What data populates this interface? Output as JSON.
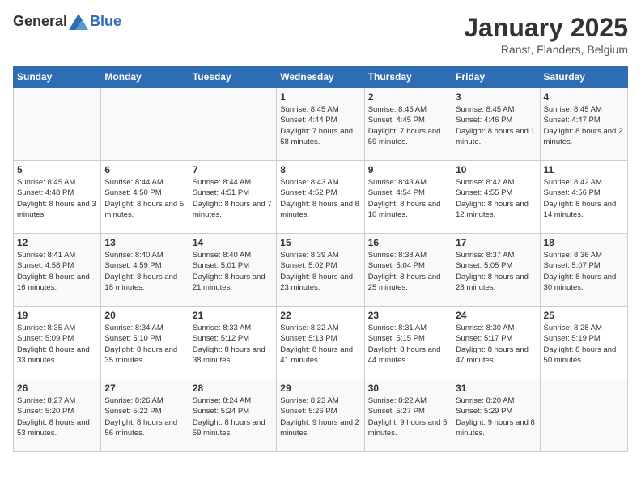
{
  "logo": {
    "general": "General",
    "blue": "Blue"
  },
  "title": "January 2025",
  "subtitle": "Ranst, Flanders, Belgium",
  "weekdays": [
    "Sunday",
    "Monday",
    "Tuesday",
    "Wednesday",
    "Thursday",
    "Friday",
    "Saturday"
  ],
  "weeks": [
    [
      {
        "day": "",
        "sunrise": "",
        "sunset": "",
        "daylight": ""
      },
      {
        "day": "",
        "sunrise": "",
        "sunset": "",
        "daylight": ""
      },
      {
        "day": "",
        "sunrise": "",
        "sunset": "",
        "daylight": ""
      },
      {
        "day": "1",
        "sunrise": "Sunrise: 8:45 AM",
        "sunset": "Sunset: 4:44 PM",
        "daylight": "Daylight: 7 hours and 58 minutes."
      },
      {
        "day": "2",
        "sunrise": "Sunrise: 8:45 AM",
        "sunset": "Sunset: 4:45 PM",
        "daylight": "Daylight: 7 hours and 59 minutes."
      },
      {
        "day": "3",
        "sunrise": "Sunrise: 8:45 AM",
        "sunset": "Sunset: 4:46 PM",
        "daylight": "Daylight: 8 hours and 1 minute."
      },
      {
        "day": "4",
        "sunrise": "Sunrise: 8:45 AM",
        "sunset": "Sunset: 4:47 PM",
        "daylight": "Daylight: 8 hours and 2 minutes."
      }
    ],
    [
      {
        "day": "5",
        "sunrise": "Sunrise: 8:45 AM",
        "sunset": "Sunset: 4:48 PM",
        "daylight": "Daylight: 8 hours and 3 minutes."
      },
      {
        "day": "6",
        "sunrise": "Sunrise: 8:44 AM",
        "sunset": "Sunset: 4:50 PM",
        "daylight": "Daylight: 8 hours and 5 minutes."
      },
      {
        "day": "7",
        "sunrise": "Sunrise: 8:44 AM",
        "sunset": "Sunset: 4:51 PM",
        "daylight": "Daylight: 8 hours and 7 minutes."
      },
      {
        "day": "8",
        "sunrise": "Sunrise: 8:43 AM",
        "sunset": "Sunset: 4:52 PM",
        "daylight": "Daylight: 8 hours and 8 minutes."
      },
      {
        "day": "9",
        "sunrise": "Sunrise: 8:43 AM",
        "sunset": "Sunset: 4:54 PM",
        "daylight": "Daylight: 8 hours and 10 minutes."
      },
      {
        "day": "10",
        "sunrise": "Sunrise: 8:42 AM",
        "sunset": "Sunset: 4:55 PM",
        "daylight": "Daylight: 8 hours and 12 minutes."
      },
      {
        "day": "11",
        "sunrise": "Sunrise: 8:42 AM",
        "sunset": "Sunset: 4:56 PM",
        "daylight": "Daylight: 8 hours and 14 minutes."
      }
    ],
    [
      {
        "day": "12",
        "sunrise": "Sunrise: 8:41 AM",
        "sunset": "Sunset: 4:58 PM",
        "daylight": "Daylight: 8 hours and 16 minutes."
      },
      {
        "day": "13",
        "sunrise": "Sunrise: 8:40 AM",
        "sunset": "Sunset: 4:59 PM",
        "daylight": "Daylight: 8 hours and 18 minutes."
      },
      {
        "day": "14",
        "sunrise": "Sunrise: 8:40 AM",
        "sunset": "Sunset: 5:01 PM",
        "daylight": "Daylight: 8 hours and 21 minutes."
      },
      {
        "day": "15",
        "sunrise": "Sunrise: 8:39 AM",
        "sunset": "Sunset: 5:02 PM",
        "daylight": "Daylight: 8 hours and 23 minutes."
      },
      {
        "day": "16",
        "sunrise": "Sunrise: 8:38 AM",
        "sunset": "Sunset: 5:04 PM",
        "daylight": "Daylight: 8 hours and 25 minutes."
      },
      {
        "day": "17",
        "sunrise": "Sunrise: 8:37 AM",
        "sunset": "Sunset: 5:05 PM",
        "daylight": "Daylight: 8 hours and 28 minutes."
      },
      {
        "day": "18",
        "sunrise": "Sunrise: 8:36 AM",
        "sunset": "Sunset: 5:07 PM",
        "daylight": "Daylight: 8 hours and 30 minutes."
      }
    ],
    [
      {
        "day": "19",
        "sunrise": "Sunrise: 8:35 AM",
        "sunset": "Sunset: 5:09 PM",
        "daylight": "Daylight: 8 hours and 33 minutes."
      },
      {
        "day": "20",
        "sunrise": "Sunrise: 8:34 AM",
        "sunset": "Sunset: 5:10 PM",
        "daylight": "Daylight: 8 hours and 35 minutes."
      },
      {
        "day": "21",
        "sunrise": "Sunrise: 8:33 AM",
        "sunset": "Sunset: 5:12 PM",
        "daylight": "Daylight: 8 hours and 38 minutes."
      },
      {
        "day": "22",
        "sunrise": "Sunrise: 8:32 AM",
        "sunset": "Sunset: 5:13 PM",
        "daylight": "Daylight: 8 hours and 41 minutes."
      },
      {
        "day": "23",
        "sunrise": "Sunrise: 8:31 AM",
        "sunset": "Sunset: 5:15 PM",
        "daylight": "Daylight: 8 hours and 44 minutes."
      },
      {
        "day": "24",
        "sunrise": "Sunrise: 8:30 AM",
        "sunset": "Sunset: 5:17 PM",
        "daylight": "Daylight: 8 hours and 47 minutes."
      },
      {
        "day": "25",
        "sunrise": "Sunrise: 8:28 AM",
        "sunset": "Sunset: 5:19 PM",
        "daylight": "Daylight: 8 hours and 50 minutes."
      }
    ],
    [
      {
        "day": "26",
        "sunrise": "Sunrise: 8:27 AM",
        "sunset": "Sunset: 5:20 PM",
        "daylight": "Daylight: 8 hours and 53 minutes."
      },
      {
        "day": "27",
        "sunrise": "Sunrise: 8:26 AM",
        "sunset": "Sunset: 5:22 PM",
        "daylight": "Daylight: 8 hours and 56 minutes."
      },
      {
        "day": "28",
        "sunrise": "Sunrise: 8:24 AM",
        "sunset": "Sunset: 5:24 PM",
        "daylight": "Daylight: 8 hours and 59 minutes."
      },
      {
        "day": "29",
        "sunrise": "Sunrise: 8:23 AM",
        "sunset": "Sunset: 5:26 PM",
        "daylight": "Daylight: 9 hours and 2 minutes."
      },
      {
        "day": "30",
        "sunrise": "Sunrise: 8:22 AM",
        "sunset": "Sunset: 5:27 PM",
        "daylight": "Daylight: 9 hours and 5 minutes."
      },
      {
        "day": "31",
        "sunrise": "Sunrise: 8:20 AM",
        "sunset": "Sunset: 5:29 PM",
        "daylight": "Daylight: 9 hours and 8 minutes."
      },
      {
        "day": "",
        "sunrise": "",
        "sunset": "",
        "daylight": ""
      }
    ]
  ]
}
